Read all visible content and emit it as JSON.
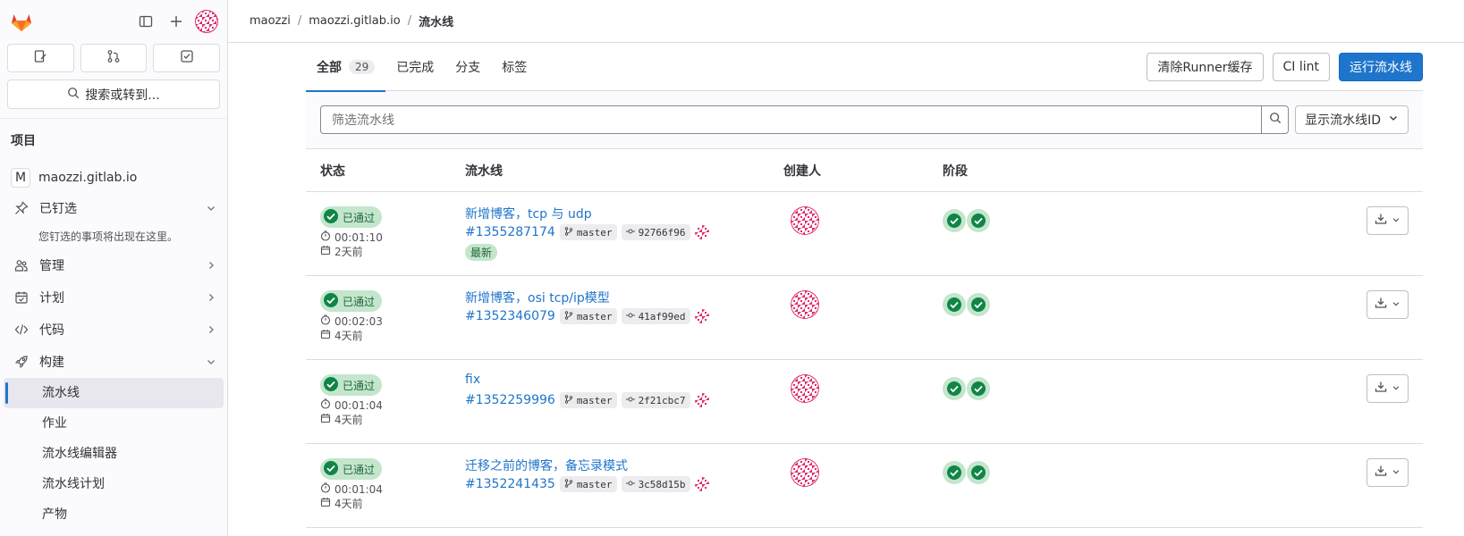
{
  "sidebar": {
    "quick_actions": [
      "issues-icon",
      "merge-requests-icon",
      "todo-icon"
    ],
    "search_label": "搜索或转到...",
    "section_title": "项目",
    "project_initial": "M",
    "project_name": "maozzi.gitlab.io",
    "pinned_label": "已钉选",
    "pinned_hint": "您钉选的事项将出现在这里。",
    "nav": {
      "manage": "管理",
      "plan": "计划",
      "code": "代码",
      "build": "构建"
    },
    "build_items": [
      "流水线",
      "作业",
      "流水线编辑器",
      "流水线计划",
      "产物"
    ]
  },
  "breadcrumb": [
    "maozzi",
    "maozzi.gitlab.io",
    "流水线"
  ],
  "tabs": {
    "all_label": "全部",
    "all_count": "29",
    "finished": "已完成",
    "branches": "分支",
    "tags": "标签"
  },
  "actions": {
    "clear_cache": "清除Runner缓存",
    "ci_lint": "CI lint",
    "run_pipeline": "运行流水线"
  },
  "filter": {
    "placeholder": "筛选流水线",
    "id_dropdown": "显示流水线ID"
  },
  "table": {
    "headers": {
      "status": "状态",
      "pipeline": "流水线",
      "creator": "创建人",
      "stages": "阶段"
    },
    "rows": [
      {
        "status": "已通过",
        "duration": "00:01:10",
        "finished": "2天前",
        "title": "新增博客，tcp 与 udp",
        "id": "#1355287174",
        "branch": "master",
        "commit": "92766f96",
        "latest": "最新"
      },
      {
        "status": "已通过",
        "duration": "00:02:03",
        "finished": "4天前",
        "title": "新增博客，osi tcp/ip模型",
        "id": "#1352346079",
        "branch": "master",
        "commit": "41af99ed"
      },
      {
        "status": "已通过",
        "duration": "00:01:04",
        "finished": "4天前",
        "title": "fix",
        "id": "#1352259996",
        "branch": "master",
        "commit": "2f21cbc7"
      },
      {
        "status": "已通过",
        "duration": "00:01:04",
        "finished": "4天前",
        "title": "迁移之前的博客，备忘录模式",
        "id": "#1352241435",
        "branch": "master",
        "commit": "3c58d15b"
      }
    ]
  },
  "colors": {
    "accent": "#1f75cb",
    "success_bg": "#c3e6cd",
    "success_fg": "#108548",
    "avatar": "#e0276a"
  }
}
